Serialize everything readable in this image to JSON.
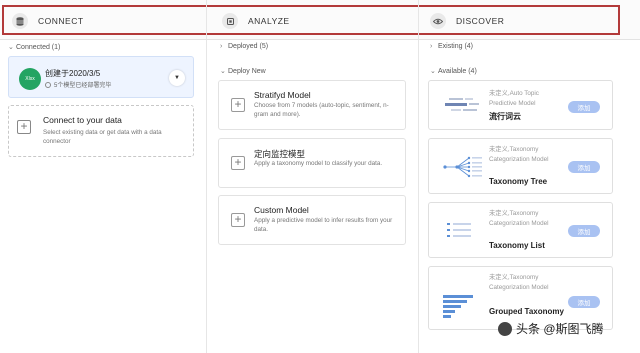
{
  "header": {
    "tabs": [
      {
        "label": "CONNECT",
        "icon": "database-icon"
      },
      {
        "label": "ANALYZE",
        "icon": "chip-icon"
      },
      {
        "label": "DISCOVER",
        "icon": "eye-icon"
      }
    ],
    "highlight_color": "#b33a3a"
  },
  "connect": {
    "section_label": "Connected (1)",
    "card": {
      "icon_text": "Xlsx",
      "title": "创建于2020/3/5",
      "subtitle": "5个模型已经部署完毕"
    },
    "add": {
      "title": "Connect to your data",
      "desc": "Select existing data or get data with a data connector"
    }
  },
  "analyze": {
    "deployed_label": "Deployed (5)",
    "deploy_new_label": "Deploy New",
    "models": [
      {
        "title": "Stratifyd Model",
        "desc": "Choose from 7 models (auto-topic, sentiment, n-gram and more)."
      },
      {
        "title": "定向监控模型",
        "desc": "Apply a taxonomy model to classify your data."
      },
      {
        "title": "Custom Model",
        "desc": "Apply a predictive model to infer results from your data."
      }
    ]
  },
  "discover": {
    "existing_label": "Existing (4)",
    "available_label": "Available (4)",
    "add_label": "添加",
    "cards": [
      {
        "type": "未定义,Auto Topic Predictive Model",
        "name": "流行词云"
      },
      {
        "type": "未定义,Taxonomy Categorization Model",
        "name": "Taxonomy Tree"
      },
      {
        "type": "未定义,Taxonomy Categorization Model",
        "name": "Taxonomy List"
      },
      {
        "type": "未定义,Taxonomy Categorization Model",
        "name": "Grouped Taxonomy"
      }
    ]
  },
  "watermark": "头条 @斯图飞腾",
  "colors": {
    "accent": "#a9c2f2",
    "xlsx": "#23a463"
  }
}
